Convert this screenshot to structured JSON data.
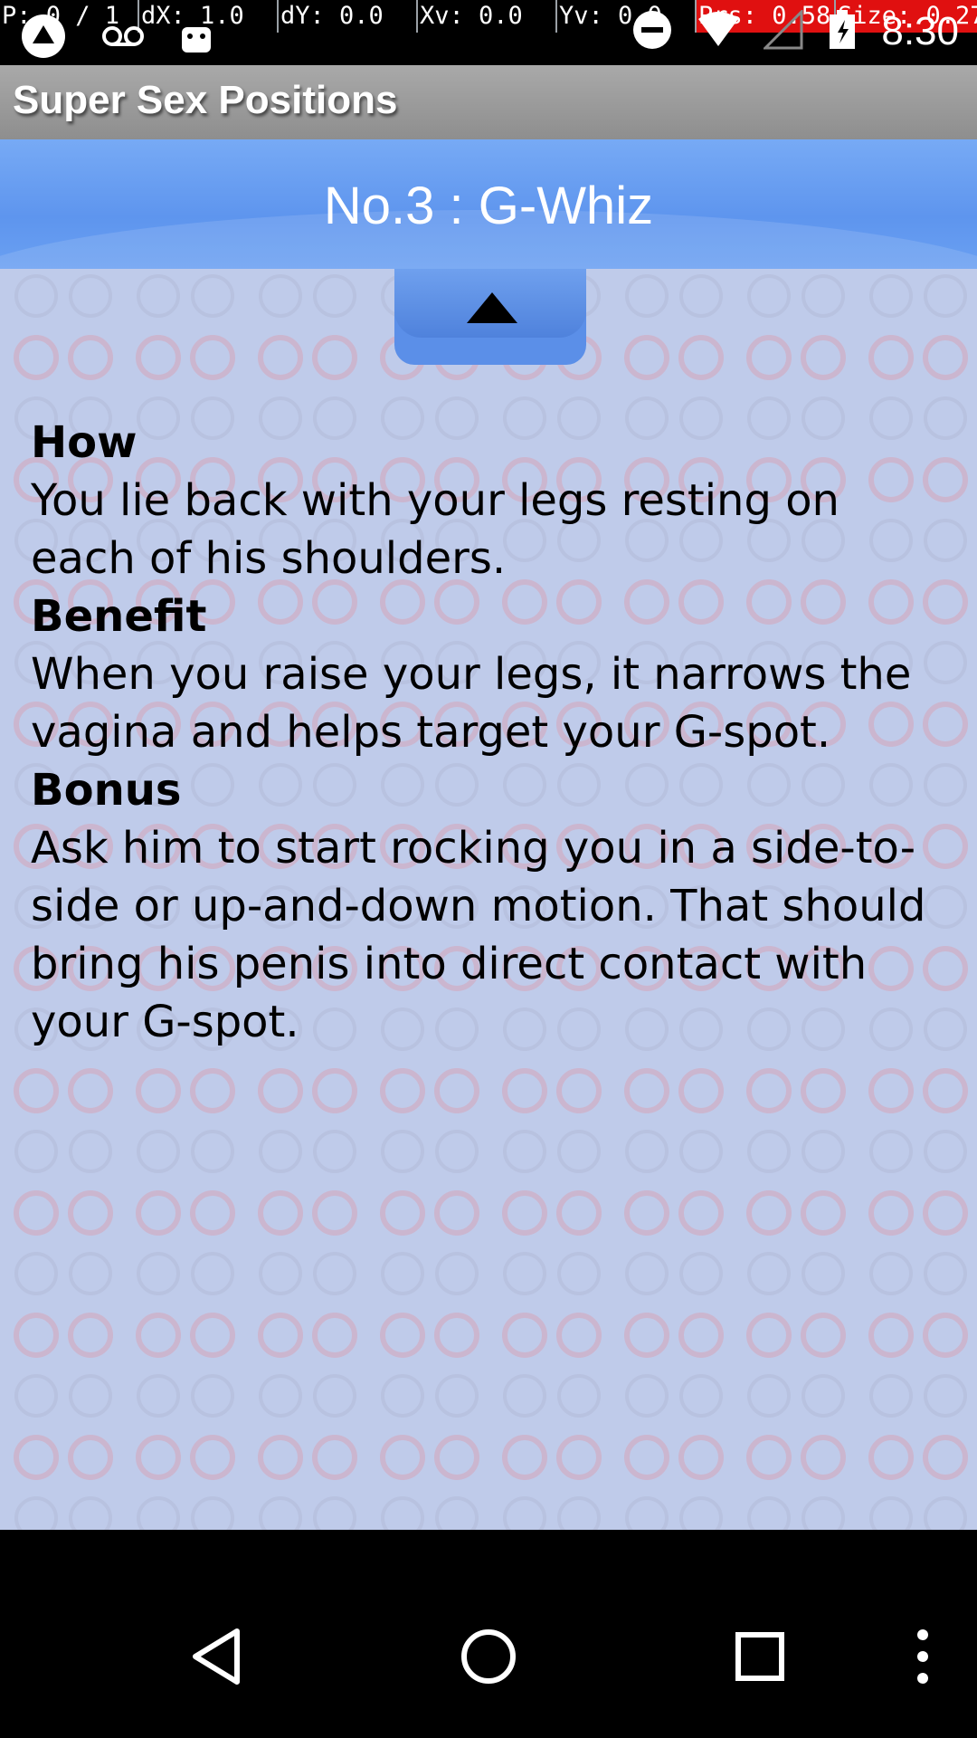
{
  "status_bar": {
    "debug": [
      {
        "text": "P: 0 / 1"
      },
      {
        "text": "dX: 1.0"
      },
      {
        "text": "dY: 0.0"
      },
      {
        "text": "Xv: 0.0"
      },
      {
        "text": "Yv: 0.0"
      },
      {
        "text": "Prs: 0.58"
      },
      {
        "text": "Size: 0.27"
      }
    ],
    "time": "8:30",
    "icons_left": [
      "app-notification-icon",
      "voicemail-icon",
      "android-icon"
    ],
    "icons_right": [
      "do-not-disturb-icon",
      "wifi-icon",
      "signal-icon",
      "battery-icon"
    ]
  },
  "action_bar": {
    "title": "Super Sex Positions"
  },
  "header": {
    "title": "No.3 : G-Whiz"
  },
  "content": {
    "how_heading": "How",
    "how_text": "You lie back with your legs resting on each of his shoulders.",
    "benefit_heading": "Benefit",
    "benefit_text": "When you raise your legs, it narrows the vagina and helps target your G-spot.",
    "bonus_heading": "Bonus",
    "bonus_text": "Ask him to start rocking you in a side-to-side or up-and-down motion. That should bring his penis into direct contact with your G-spot."
  },
  "colors": {
    "header_blue": "#5e95ee",
    "content_bg": "#c6cfe9",
    "action_bar": "#9b9b9b"
  },
  "nav_bar": {
    "buttons": [
      "back-icon",
      "home-icon",
      "recents-icon",
      "overflow-menu-icon"
    ]
  }
}
